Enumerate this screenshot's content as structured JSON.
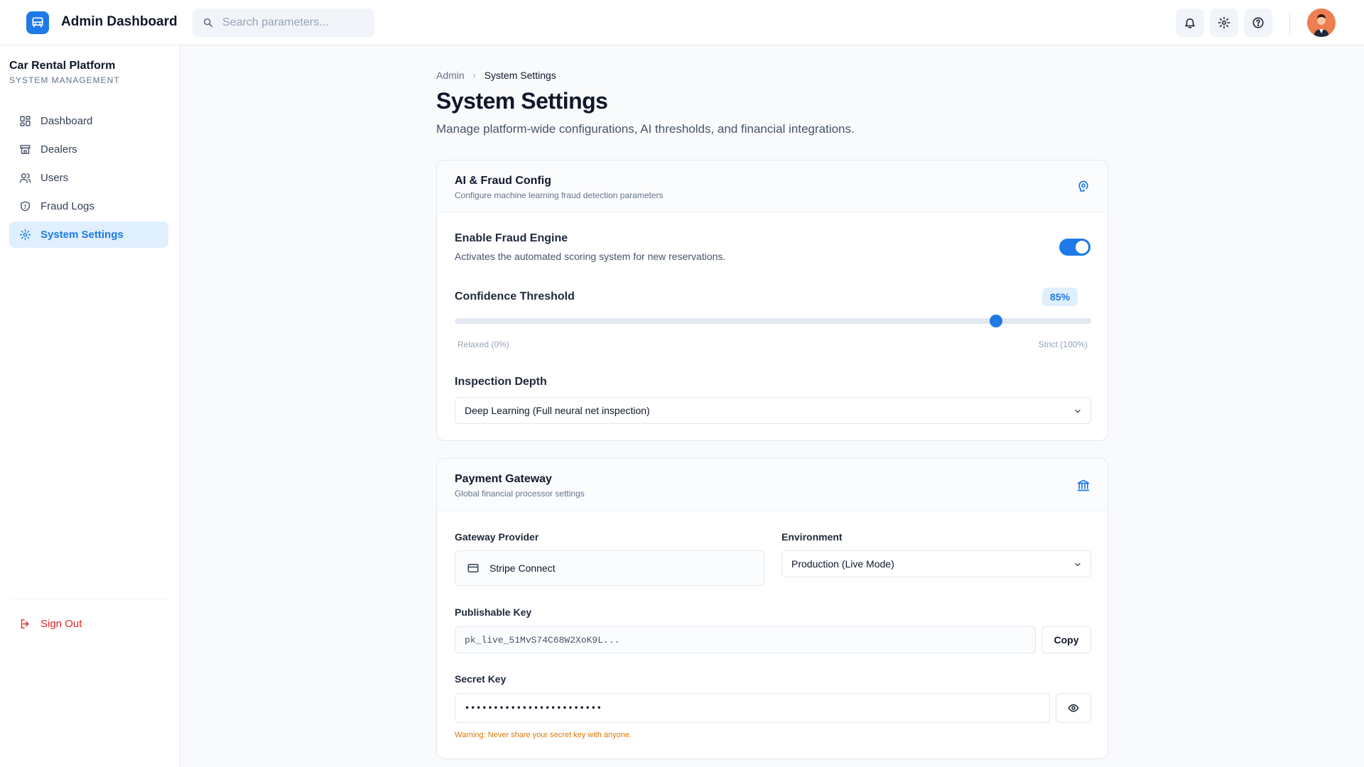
{
  "app": {
    "title": "Admin Dashboard"
  },
  "search": {
    "placeholder": "Search parameters..."
  },
  "header_icons": [
    "bell-icon",
    "gear-icon",
    "help-icon"
  ],
  "sidebar": {
    "platform_name": "Car Rental Platform",
    "platform_sub": "SYSTEM MANAGEMENT",
    "items": [
      {
        "label": "Dashboard",
        "icon": "grid-icon",
        "active": false
      },
      {
        "label": "Dealers",
        "icon": "store-icon",
        "active": false
      },
      {
        "label": "Users",
        "icon": "users-icon",
        "active": false
      },
      {
        "label": "Fraud Logs",
        "icon": "shield-icon",
        "active": false
      },
      {
        "label": "System Settings",
        "icon": "gear-icon",
        "active": true
      }
    ],
    "signout": "Sign Out"
  },
  "breadcrumb": {
    "root": "Admin",
    "current": "System Settings"
  },
  "page": {
    "title": "System Settings",
    "description": "Manage platform-wide configurations, AI thresholds, and financial integrations."
  },
  "ai_card": {
    "title": "AI & Fraud Config",
    "subtitle": "Configure machine learning fraud detection parameters",
    "icon": "brain-icon",
    "engine_label": "Enable Fraud Engine",
    "engine_desc": "Activates the automated scoring system for new reservations.",
    "engine_enabled": true,
    "threshold_label": "Confidence Threshold",
    "threshold_value": "85%",
    "threshold_fraction": 0.85,
    "min_label": "Relaxed (0%)",
    "max_label": "Strict (100%)",
    "depth_label": "Inspection Depth",
    "depth_value": "Deep Learning (Full neural net inspection)"
  },
  "payment_card": {
    "title": "Payment Gateway",
    "subtitle": "Global financial processor settings",
    "icon": "bank-icon",
    "provider_label": "Gateway Provider",
    "provider_value": "Stripe Connect",
    "env_label": "Environment",
    "env_value": "Production (Live Mode)",
    "pub_label": "Publishable Key",
    "pub_value": "pk_live_51MvS74C68W2XoK9L...",
    "copy_label": "Copy",
    "secret_label": "Secret Key",
    "secret_value": "••••••••••••••••••••••••",
    "warning": "Warning: Never share your secret key with anyone."
  },
  "colors": {
    "accent": "#1d7ae6",
    "danger": "#dc2626",
    "warning": "#d97706"
  }
}
